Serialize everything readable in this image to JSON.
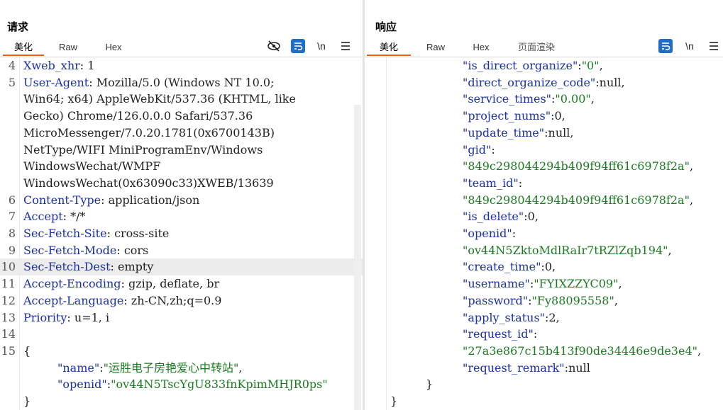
{
  "request": {
    "title": "请求",
    "tabs": [
      {
        "label": "美化",
        "active": true
      },
      {
        "label": "Raw",
        "active": false
      },
      {
        "label": "Hex",
        "active": false
      }
    ],
    "newline_toggle": "\\n",
    "lines": [
      {
        "n": "4",
        "key": "Xweb_xhr",
        "value": "1"
      },
      {
        "n": "5",
        "key": "User-Agent",
        "value": "Mozilla/5.0 (Windows NT 10.0;"
      },
      {
        "n": "",
        "plain": "Win64; x64) AppleWebKit/537.36 (KHTML, like"
      },
      {
        "n": "",
        "plain": "Gecko) Chrome/126.0.0.0 Safari/537.36"
      },
      {
        "n": "",
        "plain": "MicroMessenger/7.0.20.1781(0x6700143B)"
      },
      {
        "n": "",
        "plain": "NetType/WIFI MiniProgramEnv/Windows"
      },
      {
        "n": "",
        "plain": "WindowsWechat/WMPF"
      },
      {
        "n": "",
        "plain": "WindowsWechat(0x63090c33)XWEB/13639"
      },
      {
        "n": "6",
        "key": "Content-Type",
        "value": "application/json"
      },
      {
        "n": "7",
        "key": "Accept",
        "value": "*/*"
      },
      {
        "n": "8",
        "key": "Sec-Fetch-Site",
        "value": "cross-site"
      },
      {
        "n": "9",
        "key": "Sec-Fetch-Mode",
        "value": "cors"
      },
      {
        "n": "10",
        "key": "Sec-Fetch-Dest",
        "value": "empty",
        "highlight": true
      },
      {
        "n": "11",
        "key": "Accept-Encoding",
        "value": "gzip, deflate, br"
      },
      {
        "n": "12",
        "key": "Accept-Language",
        "value": "zh-CN,zh;q=0.9"
      },
      {
        "n": "13",
        "key": "Priority",
        "value": "u=1, i"
      },
      {
        "n": "14",
        "plain": ""
      },
      {
        "n": "15",
        "plain": "{"
      },
      {
        "n": "",
        "jkey": "\"name\"",
        "jval": "\"运胜电子房艳爱心中转站\"",
        "comma": ",",
        "indent": 2
      },
      {
        "n": "",
        "jkey": "\"openid\"",
        "jval": "\"ov44N5TscYgU833fnKpimMHJR0ps\"",
        "comma": "",
        "indent": 2
      },
      {
        "n": "",
        "plain": "}"
      }
    ]
  },
  "response": {
    "title": "响应",
    "tabs": [
      {
        "label": "美化",
        "active": true
      },
      {
        "label": "Raw",
        "active": false
      },
      {
        "label": "Hex",
        "active": false
      },
      {
        "label": "页面渲染",
        "active": false
      }
    ],
    "newline_toggle": "\\n",
    "lines": [
      {
        "jkey": "\"is_direct_organize\"",
        "jval": "\"0\"",
        "comma": ","
      },
      {
        "jkey": "\"direct_organize_code\"",
        "jraw": "null",
        "comma": ","
      },
      {
        "jkey": "\"service_times\"",
        "jval": "\"0.00\"",
        "comma": ","
      },
      {
        "jkey": "\"project_nums\"",
        "jraw": "0",
        "comma": ","
      },
      {
        "jkey": "\"update_time\"",
        "jraw": "null",
        "comma": ","
      },
      {
        "jkey": "\"gid\"",
        "jraw": "",
        "comma": ""
      },
      {
        "jval": "\"849c298044294b409f94ff61c6978f2a\"",
        "comma": ","
      },
      {
        "jkey": "\"team_id\"",
        "jraw": "",
        "comma": ""
      },
      {
        "jval": "\"849c298044294b409f94ff61c6978f2a\"",
        "comma": ","
      },
      {
        "jkey": "\"is_delete\"",
        "jraw": "0",
        "comma": ","
      },
      {
        "jkey": "\"openid\"",
        "jraw": "",
        "comma": ""
      },
      {
        "jval": "\"ov44N5ZktoMdlRaIr7tRZlZqb194\"",
        "comma": ","
      },
      {
        "jkey": "\"create_time\"",
        "jraw": "0",
        "comma": ","
      },
      {
        "jkey": "\"username\"",
        "jval": "\"FYIXZZYC09\"",
        "comma": ","
      },
      {
        "jkey": "\"password\"",
        "jval": "\"Fy88095558\"",
        "comma": ","
      },
      {
        "jkey": "\"apply_status\"",
        "jraw": "2",
        "comma": ","
      },
      {
        "jkey": "\"request_id\"",
        "jraw": "",
        "comma": ""
      },
      {
        "jval": "\"27a3e867c15b413f90de34446e9de3e4\"",
        "comma": ","
      },
      {
        "jkey": "\"request_remark\"",
        "jraw": "null",
        "comma": ""
      },
      {
        "brace": "}",
        "indent": 1
      },
      {
        "brace": "}",
        "indent": 0
      }
    ]
  },
  "colors": {
    "accent_tab": "#e8601c",
    "active_blue": "#1e6ec8",
    "key_blue": "#1a2fa8",
    "string_green": "#1a7a20"
  },
  "icons": [
    "eye-off-icon",
    "wrap-icon",
    "newline-icon",
    "menu-icon",
    "layout-split-icon",
    "layout-rows-icon",
    "layout-single-icon"
  ]
}
